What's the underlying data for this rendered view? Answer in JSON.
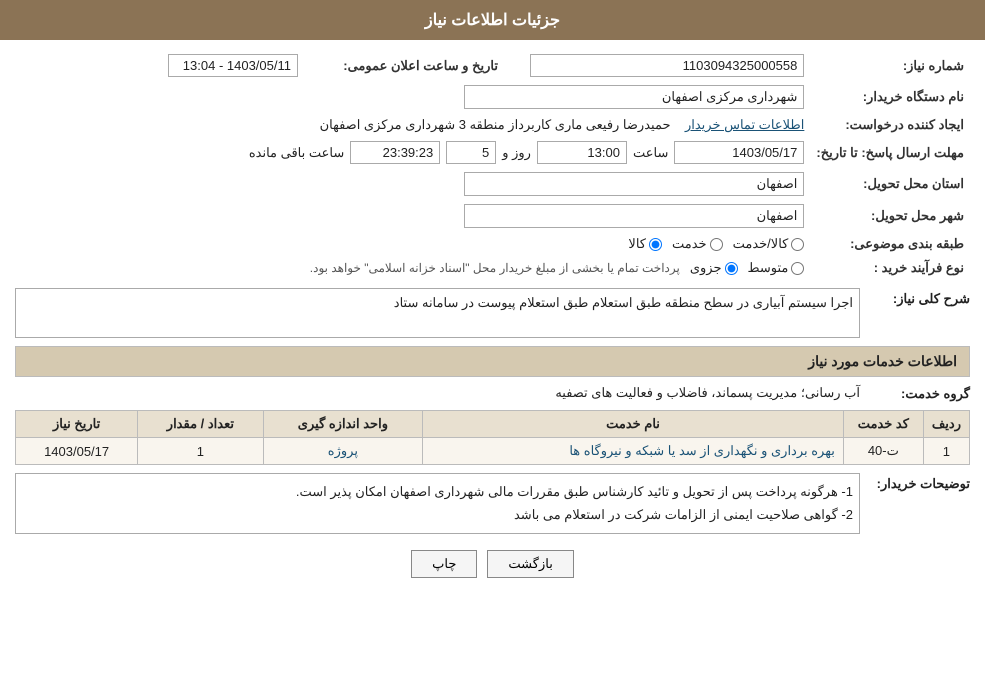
{
  "header": {
    "title": "جزئیات اطلاعات نیاز"
  },
  "fields": {
    "need_number_label": "شماره نیاز:",
    "need_number_value": "1103094325000558",
    "buyer_org_label": "نام دستگاه خریدار:",
    "buyer_org_value": "شهرداری مرکزی اصفهان",
    "requester_label": "ایجاد کننده درخواست:",
    "requester_value": "حمیدرضا رفیعی ماری کاربرداز منطقه 3 شهرداری مرکزی اصفهان",
    "contact_link": "اطلاعات تماس خریدار",
    "announcement_label": "تاریخ و ساعت اعلان عمومی:",
    "announcement_value": "1403/05/11 - 13:04",
    "reply_deadline_label": "مهلت ارسال پاسخ: تا تاریخ:",
    "reply_date": "1403/05/17",
    "reply_time_label": "ساعت",
    "reply_time": "13:00",
    "reply_days_label": "روز و",
    "reply_days": "5",
    "reply_remaining_label": "ساعت باقی مانده",
    "reply_remaining": "23:39:23",
    "delivery_province_label": "استان محل تحویل:",
    "delivery_province_value": "اصفهان",
    "delivery_city_label": "شهر محل تحویل:",
    "delivery_city_value": "اصفهان",
    "category_label": "طبقه بندی موضوعی:",
    "category_kala": "کالا",
    "category_khedmat": "خدمت",
    "category_kala_khedmat": "کالا/خدمت",
    "process_label": "نوع فرآیند خرید :",
    "process_jozvi": "جزوی",
    "process_motavaset": "متوسط",
    "process_note": "پرداخت تمام یا بخشی از مبلغ خریدار محل \"اسناد خزانه اسلامی\" خواهد بود.",
    "need_description_label": "شرح کلی نیاز:",
    "need_description_value": "اجرا سیستم آبیاری در سطح منطقه طبق استعلام طبق استعلام پیوست در سامانه ستاد",
    "services_header": "اطلاعات خدمات مورد نیاز",
    "service_group_label": "گروه خدمت:",
    "service_group_value": "آب رسانی؛ مدیریت پسماند، فاضلاب و فعالیت های تصفیه",
    "table": {
      "col_number": "ردیف",
      "col_code": "کد خدمت",
      "col_name": "نام خدمت",
      "col_unit": "واحد اندازه گیری",
      "col_quantity": "تعداد / مقدار",
      "col_date": "تاریخ نیاز",
      "rows": [
        {
          "number": "1",
          "code": "ت-40",
          "name": "بهره برداری و نگهداری از سد یا شبکه و نیروگاه ها",
          "unit": "پروژه",
          "quantity": "1",
          "date": "1403/05/17"
        }
      ]
    },
    "buyer_notes_label": "توضیحات خریدار:",
    "buyer_notes_line1": "1- هرگونه پرداخت پس از تحویل و تائید کارشناس طبق مقررات مالی شهرداری اصفهان امکان پذیر است.",
    "buyer_notes_line2": "2- گواهی صلاحیت ایمنی از الزامات شرکت در استعلام می باشد"
  },
  "buttons": {
    "print": "چاپ",
    "back": "بازگشت"
  }
}
